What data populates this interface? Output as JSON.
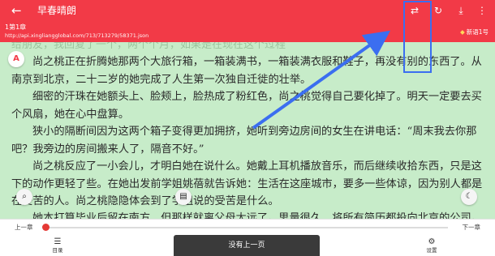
{
  "appbar": {
    "back_icon": "←",
    "title": "早春晴朗",
    "actions": [
      "⇄",
      "↻",
      "⤓",
      "⋮"
    ]
  },
  "subbar": {
    "chapter": "1第1章",
    "url": "http://api.xingliangglobal.com/713/713279/58371.json",
    "source": "新语1号"
  },
  "reader": {
    "ghost_line": "给朋友，我回复了一个，两个个月，如果是在现在这个过程",
    "paragraphs": [
      [
        "尚之桃正在折腾她那两个大旅行箱，一箱装满书，一箱装满衣服和鞋子，再没有别的东西了。从南京到北京，二十二岁的她完成了人生第一次独自迁徙的壮举。"
      ],
      [
        "细密的汗珠在她额头上、脸颊上，脸热成了粉红色，尚之桃觉得自己要化掉了。明天一定要去买个风扇，她在心中盘算。"
      ],
      [
        "狭小的隔断间因为这两个箱子变得更加拥挤，她听到旁边房间的女生在讲电话：“周末我去你那吧？我旁边的房间搬来人了，隔音不好。”"
      ],
      [
        "尚之桃反应了一小会儿，才明白她在说什么。她戴上耳机播放音乐，而后继续收拾东西，只是这下的动作更轻了些。在她出发前学姐姚蓓就告诉她：生活在这座城市，要多一些体谅，因为别人都是在受苦的人。尚之桃隐隐体会到了学姐说的受苦是什么。"
      ],
      [
        "她本打算毕业后留在南方，但那样就离父母太远了。思量很久，将所有简历都投向北京的公司。"
      ]
    ]
  },
  "bottom": {
    "prev_label": "上一章",
    "next_label": "下一章",
    "progress": 0,
    "catalog_label": "目录",
    "settings_label": "设置"
  },
  "toast": "没有上一页",
  "colors": {
    "accent": "#f23a47",
    "reader_bg": "#c7ecc9",
    "annotation": "#3b6ef0"
  }
}
